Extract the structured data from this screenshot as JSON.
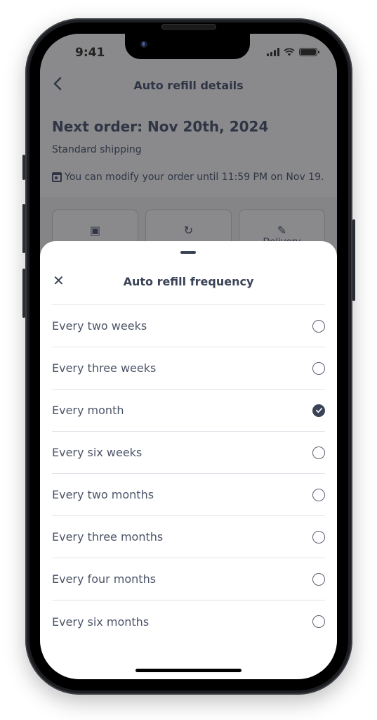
{
  "status_bar": {
    "time": "9:41",
    "icons": [
      "cellular-signal-icon",
      "wifi-icon",
      "battery-icon"
    ]
  },
  "background_screen": {
    "nav": {
      "back_icon": "chevron-left-icon",
      "title": "Auto refill details"
    },
    "order_title": "Next order: Nov 20th, 2024",
    "shipping": "Standard shipping",
    "modify_note": "You can modify your order until 11:59 PM on Nov 19.",
    "tiles": [
      {
        "icon": "calendar-icon",
        "glyph": "▣",
        "label": ""
      },
      {
        "icon": "refresh-icon",
        "glyph": "↻",
        "label": ""
      },
      {
        "icon": "pencil-icon",
        "glyph": "✎",
        "label": "Delivery"
      }
    ]
  },
  "sheet": {
    "close_icon": "close-icon",
    "close_glyph": "✕",
    "title": "Auto refill frequency",
    "selected_index": 2,
    "options": [
      {
        "label": "Every two weeks",
        "selected": false
      },
      {
        "label": "Every three weeks",
        "selected": false
      },
      {
        "label": "Every month",
        "selected": true
      },
      {
        "label": "Every six weeks",
        "selected": false
      },
      {
        "label": "Every two months",
        "selected": false
      },
      {
        "label": "Every three months",
        "selected": false
      },
      {
        "label": "Every four months",
        "selected": false
      },
      {
        "label": "Every six months",
        "selected": false
      }
    ]
  },
  "colors": {
    "overlay_dim": "#8a8a8c",
    "text_primary": "#3b4456",
    "option_text": "#4c5468",
    "divider": "#e1e3ea",
    "radio_selected": "#3b4456"
  }
}
